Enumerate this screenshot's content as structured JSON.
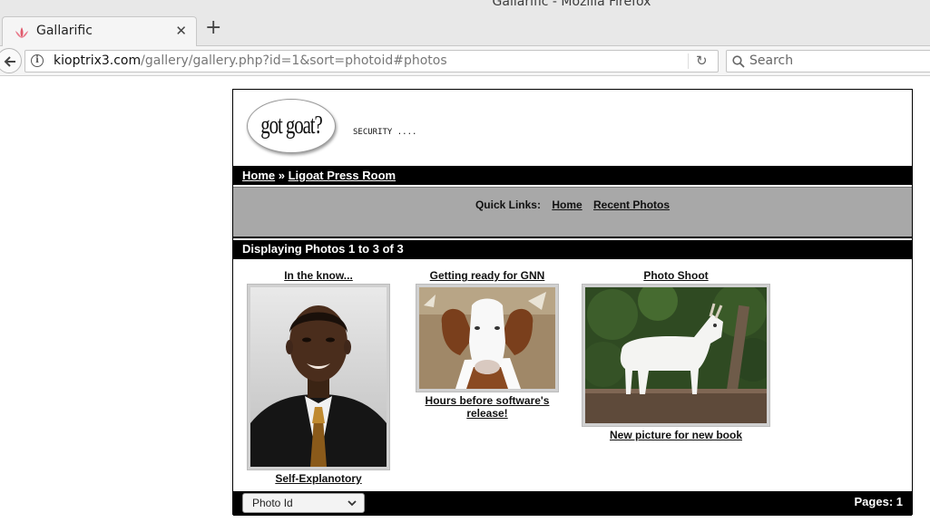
{
  "window": {
    "title": "Gallarific - Mozilla Firefox"
  },
  "browser": {
    "tab_title": "Gallarific",
    "url_host": "kioptrix3.com",
    "url_path": "/gallery/gallery.php?id=1&sort=photoid#photos",
    "search_placeholder": "Search"
  },
  "site": {
    "logo_text": "got goat?",
    "tagline": "SECURITY ....",
    "breadcrumb": {
      "home": "Home",
      "separator": "»",
      "current": "Ligoat Press Room"
    },
    "quick_links": {
      "label": "Quick Links:",
      "home": "Home",
      "recent": "Recent Photos"
    },
    "display_text": "Displaying Photos 1 to 3 of 3",
    "photos": [
      {
        "title": "In the know...",
        "caption": "Self-Explanotory",
        "icon": "portrait-photo"
      },
      {
        "title": "Getting ready for GNN",
        "caption": "Hours before software's release!",
        "icon": "goat-photo"
      },
      {
        "title": "Photo Shoot",
        "caption": "New picture for new book",
        "icon": "goat-photo"
      }
    ],
    "sort_selected": "Photo Id",
    "pages_text": "Pages: 1"
  }
}
